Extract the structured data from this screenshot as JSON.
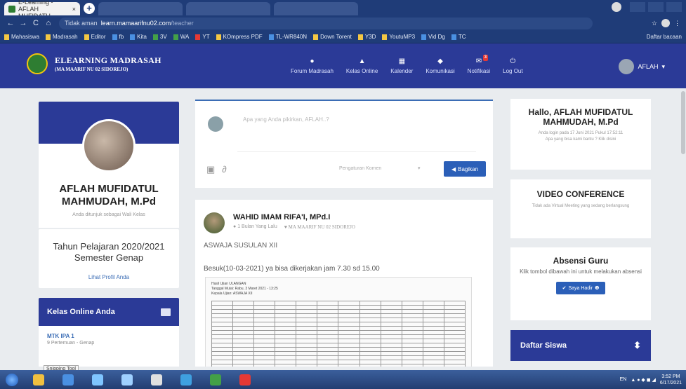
{
  "browser": {
    "tab_title": "E-Learning - AFLAH MUFIDATU",
    "tab_close": "×",
    "new_tab": "+",
    "url_warning": "Tidak aman",
    "url_host": "learn.mamaarifnu02.com",
    "url_path": "/teacher",
    "bookmarks": [
      {
        "label": "Mahasiswa",
        "color": "#f2c744"
      },
      {
        "label": "Madrasah",
        "color": "#f2c744"
      },
      {
        "label": "Editor",
        "color": "#f2c744"
      },
      {
        "label": "fb",
        "color": "#4a90e2"
      },
      {
        "label": "Kita",
        "color": "#4a90e2"
      },
      {
        "label": "3V",
        "color": "#43a047"
      },
      {
        "label": "WA",
        "color": "#43a047"
      },
      {
        "label": "YT",
        "color": "#e53935"
      },
      {
        "label": "KOmpress PDF",
        "color": "#f2c744"
      },
      {
        "label": "TL-WR840N",
        "color": "#4a90e2"
      },
      {
        "label": "Down Torent",
        "color": "#f2c744"
      },
      {
        "label": "Y3D",
        "color": "#f2c744"
      },
      {
        "label": "YoutuMP3",
        "color": "#f2c744"
      },
      {
        "label": "Vid Dg",
        "color": "#4a90e2"
      },
      {
        "label": "TC",
        "color": "#4a90e2"
      }
    ],
    "bookmarks_more": "Daftar bacaan"
  },
  "site": {
    "brand": "ELEARNING MADRASAH",
    "brand_sub": "(MA MAARIF NU 02 SIDOREJO)",
    "nav": [
      {
        "label": "Forum Madrasah",
        "icon": "chat-icon",
        "glyph": "●"
      },
      {
        "label": "Kelas Online",
        "icon": "graduation-cap-icon",
        "glyph": "▲"
      },
      {
        "label": "Kalender",
        "icon": "calendar-icon",
        "glyph": "▦"
      },
      {
        "label": "Komunikasi",
        "icon": "user-icon",
        "glyph": "◆"
      },
      {
        "label": "Notifikasi",
        "icon": "bell-icon",
        "glyph": "✉",
        "badge": "3"
      },
      {
        "label": "Log Out",
        "icon": "power-icon",
        "glyph": "⏻"
      }
    ],
    "user_label": "AFLAH"
  },
  "profile": {
    "name": "AFLAH MUFIDATUL MAHMUDAH, M.Pd",
    "role": "Anda ditunjuk sebagai Wali Kelas",
    "term": "Tahun Pelajaran 2020/2021",
    "semester": "Semester Genap",
    "profile_link": "Lihat Profil Anda"
  },
  "kelas": {
    "title": "Kelas Online Anda",
    "item": "MTK IPA 1",
    "item_sub": "9 Pertemuan - Genap",
    "tooltip": "Snipping Tool"
  },
  "composer": {
    "placeholder": "Apa yang Anda pikirkan, AFLAH..?",
    "setting": "Pengaturan Komen",
    "share_label": "Bagikan"
  },
  "feed": {
    "author": "WAHID IMAM RIFA'I, MPd.I",
    "time": "1 Bulan Yang Lalu",
    "school": "MA MAARIF NU 02 SIDOREJO",
    "title": "ASWAJA SUSULAN XII",
    "text": "Besuk(10-03-2021) ya bisa dikerjakan jam 7.30 sd 15.00",
    "attach_header": "Hasil Ujian ULANGAN",
    "attach_line2": "Tanggal Mulai: Rabu, 3 Maret 2021 - 13:25",
    "attach_line3": "Kepala Ujian: ASWAJA XII"
  },
  "right": {
    "hallo": "Hallo, AFLAH MUFIDATUL MAHMUDAH, M.Pd",
    "login_info": "Anda login pada 17 Juni 2021 Pukul 17:52:11",
    "help": "Apa yang bisa kami bantu ? Klik disini",
    "video_title": "VIDEO CONFERENCE",
    "video_sub": "Tidak ada Virtual Meeting yang sedang berlangsung",
    "absensi_title": "Absensi Guru",
    "absensi_sub": "Klik tombol dibawah ini untuk melakukan absensi",
    "hadir_btn": "Saya Hadir",
    "daftar_title": "Daftar Siswa"
  },
  "taskbar": {
    "apps": [
      {
        "name": "explorer",
        "color": "#f0c040"
      },
      {
        "name": "media",
        "color": "#4a90e2"
      },
      {
        "name": "paint",
        "color": "#7fc5ff"
      },
      {
        "name": "mail",
        "color": "#9fd0ff"
      },
      {
        "name": "phone",
        "color": "#e0e0e0"
      },
      {
        "name": "ie",
        "color": "#3fa0e0"
      },
      {
        "name": "office",
        "color": "#43a047"
      },
      {
        "name": "chrome",
        "color": "#e53935"
      }
    ],
    "lang": "EN",
    "time": "3:52 PM",
    "date": "6/17/2021"
  }
}
